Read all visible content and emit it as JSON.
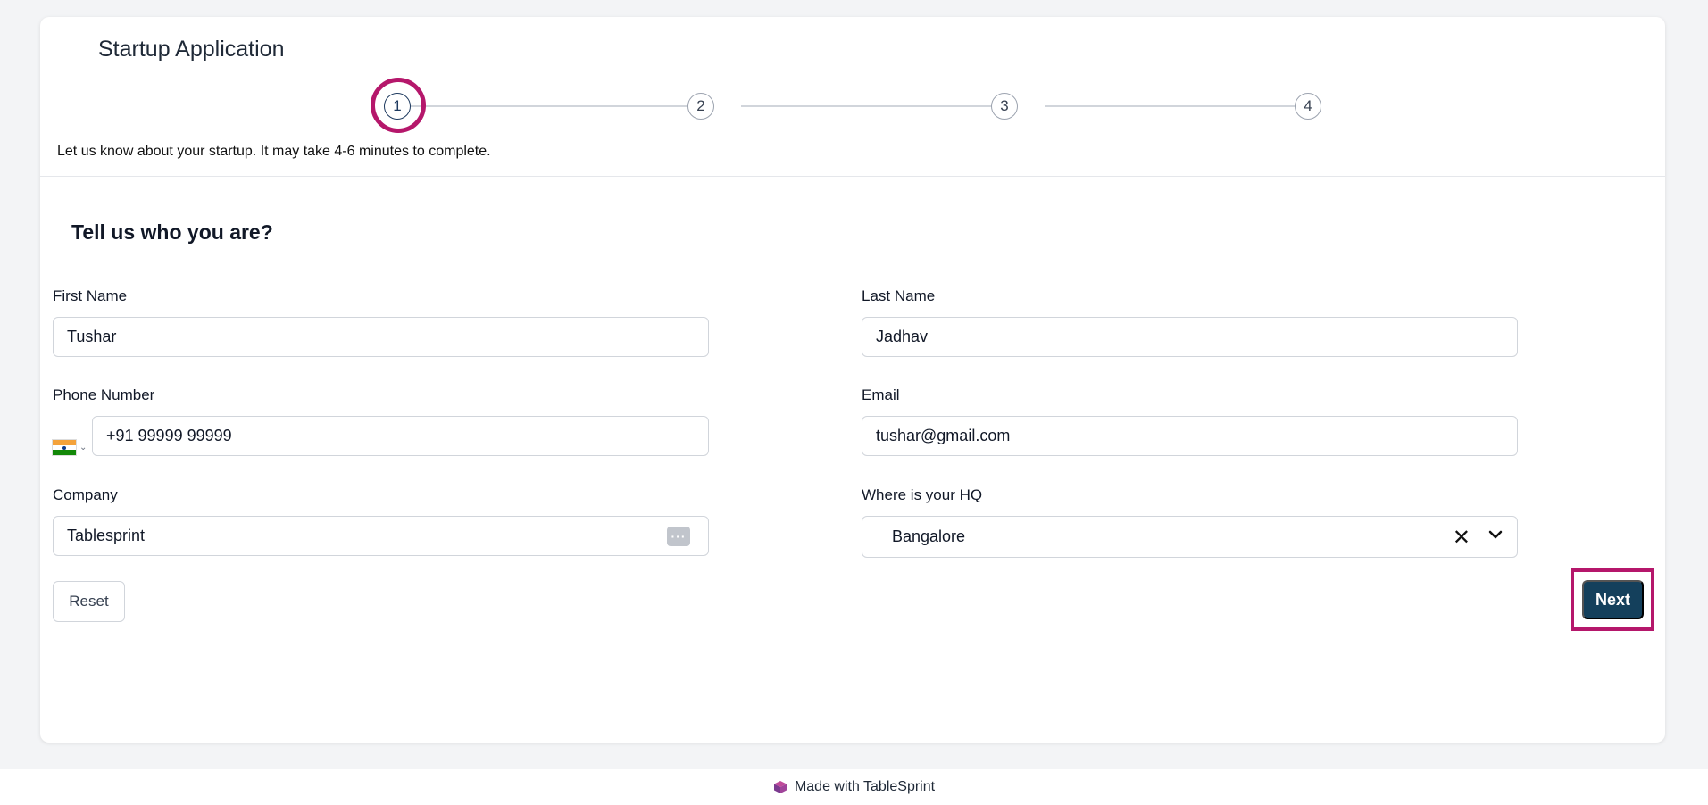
{
  "app": {
    "title": "Startup Application"
  },
  "stepper": {
    "steps": [
      "1",
      "2",
      "3",
      "4"
    ],
    "active_step": 1,
    "intro": "Let us know about your startup. It may take 4-6 minutes to complete."
  },
  "form": {
    "section_title": "Tell us who you are?",
    "first_name": {
      "label": "First Name",
      "value": "Tushar"
    },
    "last_name": {
      "label": "Last Name",
      "value": "Jadhav"
    },
    "phone": {
      "label": "Phone Number",
      "value": "+91 99999 99999",
      "country": "India"
    },
    "email": {
      "label": "Email",
      "value": "tushar@gmail.com"
    },
    "company": {
      "label": "Company",
      "value": "Tablesprint",
      "action_icon": "more-dots-icon"
    },
    "hq": {
      "label": "Where is your HQ",
      "value": "Bangalore"
    }
  },
  "actions": {
    "reset_label": "Reset",
    "next_label": "Next"
  },
  "footer": {
    "text": "Made with TableSprint"
  },
  "colors": {
    "primary": "#14405c",
    "highlight": "#b5176b",
    "background": "#f3f4f6"
  }
}
